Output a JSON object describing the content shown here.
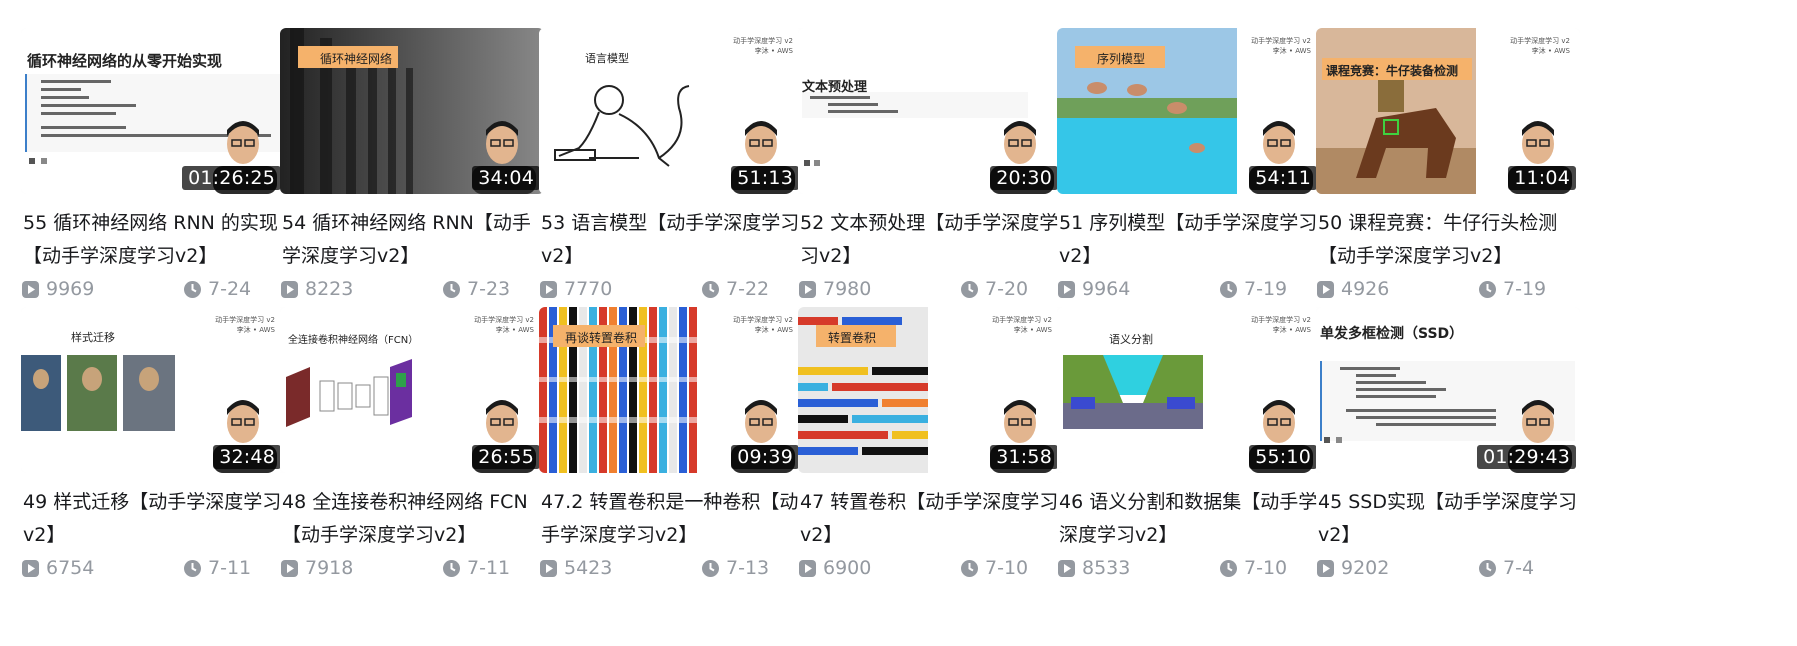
{
  "videos": [
    {
      "duration": "01:26:25",
      "title": "55 循环神经网络 RNN 的实现【动手学深度学习v2】",
      "views": "9969",
      "date": "7-24",
      "slide_text": "循环神经网络的从零开始实现"
    },
    {
      "duration": "34:04",
      "title": "54 循环神经网络 RNN【动手学深度学习v2】",
      "views": "8223",
      "date": "7-23",
      "slide_text": "循环神经网络"
    },
    {
      "duration": "51:13",
      "title": "53 语言模型【动手学深度学习v2】",
      "views": "7770",
      "date": "7-22",
      "slide_text": "语言模型"
    },
    {
      "duration": "20:30",
      "title": "52 文本预处理【动手学深度学习v2】",
      "views": "7980",
      "date": "7-20",
      "slide_text": "文本预处理"
    },
    {
      "duration": "54:11",
      "title": "51 序列模型【动手学深度学习v2】",
      "views": "9964",
      "date": "7-19",
      "slide_text": "序列模型"
    },
    {
      "duration": "11:04",
      "title": "50 课程竞赛：牛仔行头检测【动手学深度学习v2】",
      "views": "4926",
      "date": "7-19",
      "slide_text": "课程竞赛：牛仔装备检测"
    },
    {
      "duration": "32:48",
      "title": "49 样式迁移【动手学深度学习v2】",
      "views": "6754",
      "date": "7-11",
      "slide_text": "样式迁移"
    },
    {
      "duration": "26:55",
      "title": "48 全连接卷积神经网络 FCN【动手学深度学习v2】",
      "views": "7918",
      "date": "7-11",
      "slide_text": "全连接卷积神经网络（FCN）"
    },
    {
      "duration": "09:39",
      "title": "47.2 转置卷积是一种卷积【动手学深度学习v2】",
      "views": "5423",
      "date": "7-13",
      "slide_text": "再谈转置卷积"
    },
    {
      "duration": "31:58",
      "title": "47 转置卷积【动手学深度学习v2】",
      "views": "6900",
      "date": "7-10",
      "slide_text": "转置卷积"
    },
    {
      "duration": "55:10",
      "title": "46 语义分割和数据集【动手学深度学习v2】",
      "views": "8533",
      "date": "7-10",
      "slide_text": "语义分割"
    },
    {
      "duration": "01:29:43",
      "title": "45 SSD实现【动手学深度学习v2】",
      "views": "9202",
      "date": "7-4",
      "slide_text": "单发多框检测（SSD）"
    }
  ],
  "badge": {
    "line1": "动手学深度学习 v2",
    "line2": "李沐 • AWS"
  },
  "colors": {
    "text": "#18191c",
    "meta": "#9499a0",
    "orange_tag": "#f5b26b",
    "duration_bg": "#000000"
  }
}
